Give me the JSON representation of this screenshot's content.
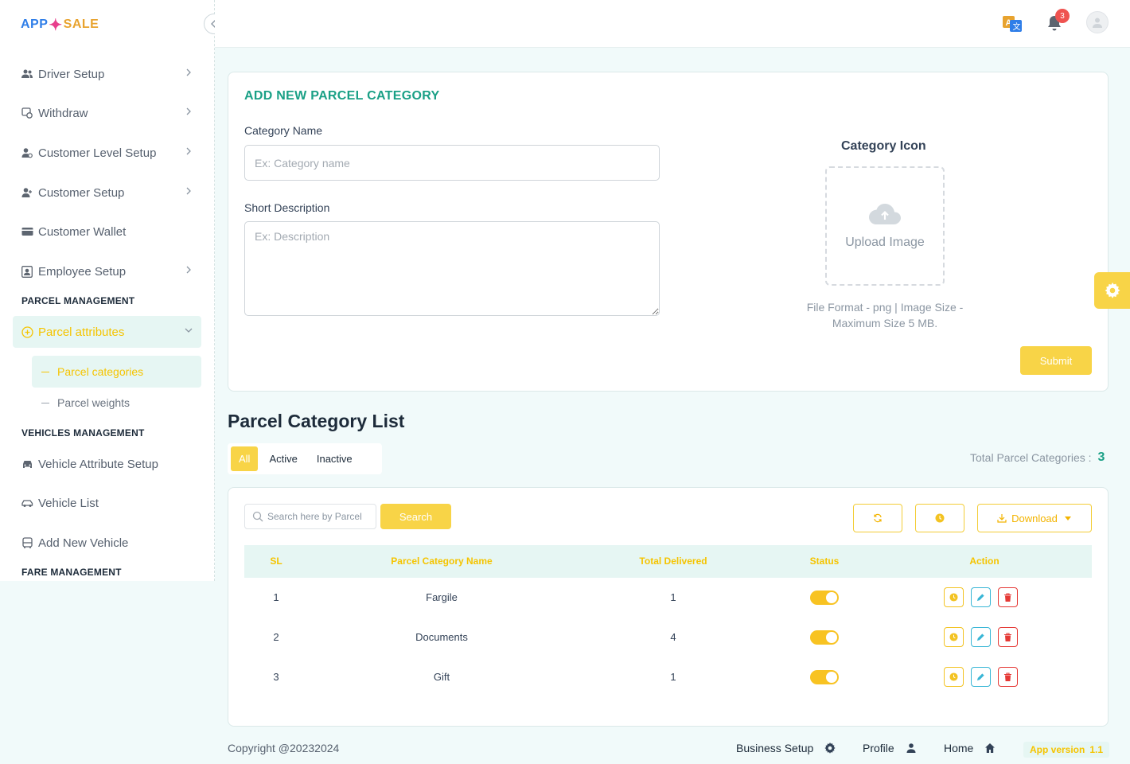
{
  "logo": {
    "part1": "APP",
    "part2": "SALE"
  },
  "sidebar": {
    "items": [
      {
        "label": "Driver Setup",
        "icon": "users-icon"
      },
      {
        "label": "Withdraw",
        "icon": "withdraw-icon"
      },
      {
        "label": "Customer Level Setup",
        "icon": "user-level-icon"
      },
      {
        "label": "Customer Setup",
        "icon": "user-plus-icon"
      },
      {
        "label": "Customer Wallet",
        "icon": "wallet-icon"
      },
      {
        "label": "Employee Setup",
        "icon": "id-card-icon"
      }
    ],
    "section_parcel": "PARCEL MANAGEMENT",
    "parcel_attributes": "Parcel attributes",
    "sub_items": [
      "Parcel categories",
      "Parcel weights"
    ],
    "section_vehicles": "VEHICLES MANAGEMENT",
    "vehicle_items": [
      {
        "label": "Vehicle Attribute Setup",
        "icon": "car-icon"
      },
      {
        "label": "Vehicle List",
        "icon": "car-side-icon"
      },
      {
        "label": "Add New Vehicle",
        "icon": "bus-icon"
      }
    ],
    "section_fare": "FARE MANAGEMENT"
  },
  "topbar": {
    "notifications_count": "3"
  },
  "form": {
    "title": "ADD NEW PARCEL CATEGORY",
    "category_name_label": "Category Name",
    "category_name_placeholder": "Ex: Category name",
    "short_description_label": "Short Description",
    "short_description_placeholder": "Ex: Description",
    "category_icon_label": "Category Icon",
    "upload_text": "Upload Image",
    "file_hint": "File Format - png | Image Size - Maximum Size 5 MB.",
    "submit_label": "Submit"
  },
  "list": {
    "title": "Parcel Category List",
    "tabs": [
      "All",
      "Active",
      "Inactive"
    ],
    "active_tab": "All",
    "total_label": "Total Parcel Categories :",
    "total_value": "3",
    "search_placeholder": "Search here by Parcel",
    "search_button": "Search",
    "download_label": "Download",
    "columns": [
      "SL",
      "Parcel Category Name",
      "Total Delivered",
      "Status",
      "Action"
    ],
    "rows": [
      {
        "sl": "1",
        "name": "Fargile",
        "delivered": "1",
        "status": true
      },
      {
        "sl": "2",
        "name": "Documents",
        "delivered": "4",
        "status": true
      },
      {
        "sl": "3",
        "name": "Gift",
        "delivered": "1",
        "status": true
      }
    ]
  },
  "footer": {
    "copyright": "Copyright @20232024",
    "business_setup": "Business Setup",
    "profile": "Profile",
    "home": "Home",
    "app_version_label": "App version",
    "app_version_value": "1.1"
  },
  "colors": {
    "accent": "#f8d447",
    "teal": "#1aa086",
    "active_bg": "#e6f6f3"
  }
}
